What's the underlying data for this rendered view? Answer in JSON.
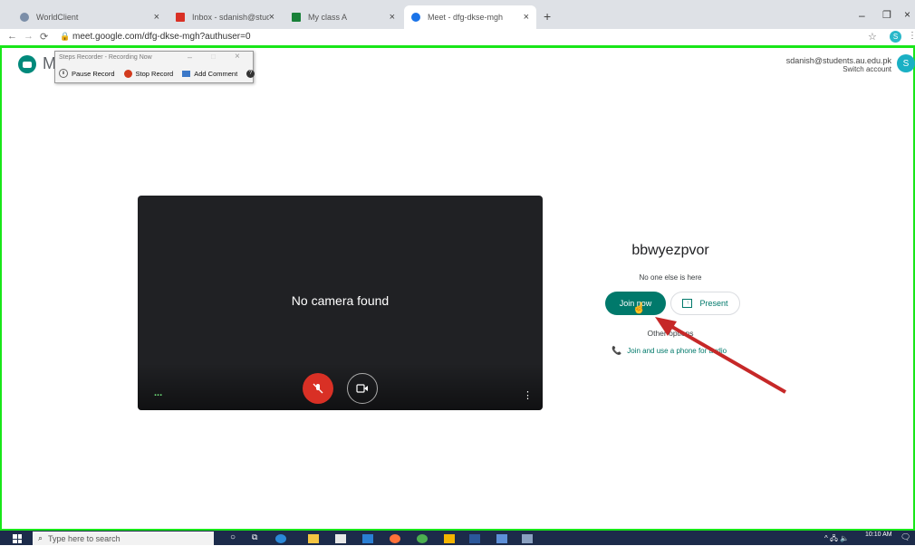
{
  "browser": {
    "tabs": [
      {
        "title": "WorldClient",
        "active": false
      },
      {
        "title": "Inbox - sdanish@students.au.edu",
        "active": false
      },
      {
        "title": "My class A",
        "active": false
      },
      {
        "title": "Meet - dfg-dkse-mgh",
        "active": true
      }
    ],
    "new_tab": "+",
    "url": "meet.google.com/dfg-dkse-mgh?authuser=0"
  },
  "steps_recorder": {
    "title": "Steps Recorder - Recording Now",
    "pause": "Pause Record",
    "stop": "Stop Record",
    "comment": "Add Comment"
  },
  "meet": {
    "logo_letter": "M",
    "account_email": "sdanish@students.au.edu.pk",
    "switch_account": "Switch account",
    "avatar_letter": "S",
    "video_message": "No camera found",
    "meeting_code": "bbwyezpvor",
    "status": "No one else is here",
    "join_button": "Join now",
    "present_button": "Present",
    "other_options": "Other options",
    "phone_audio": "Join and use a phone for audio",
    "more_dots": "..."
  },
  "taskbar": {
    "search_placeholder": "Type here to search",
    "time": "10:10 AM"
  }
}
